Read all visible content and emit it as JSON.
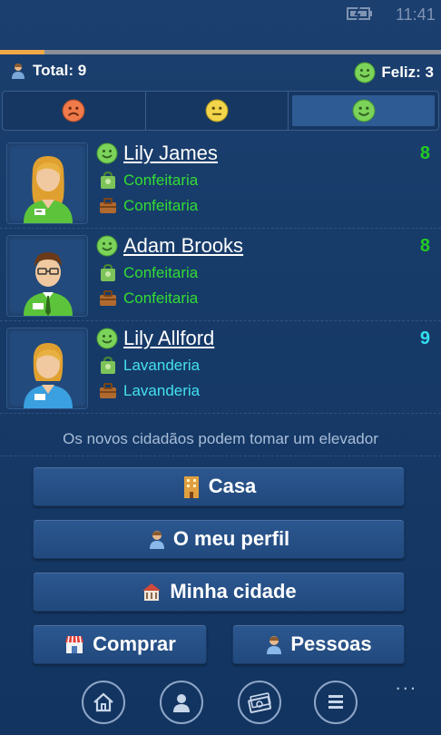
{
  "status_bar": {
    "time": "11:41"
  },
  "progress": {
    "fraction": 0.1
  },
  "summary": {
    "total_label": "Total: 9",
    "happy_label": "Feliz: 3"
  },
  "tabs": [
    {
      "name": "unhappy",
      "active": false
    },
    {
      "name": "neutral",
      "active": false
    },
    {
      "name": "happy",
      "active": true
    }
  ],
  "citizens": [
    {
      "name": "Lily James",
      "score": "8",
      "score_color": "#22cc22",
      "home": "Confeitaria",
      "work": "Confeitaria",
      "job_color": "#33dd33",
      "avatar": "woman-green"
    },
    {
      "name": "Adam Brooks",
      "score": "8",
      "score_color": "#22cc22",
      "home": "Confeitaria",
      "work": "Confeitaria",
      "job_color": "#33dd33",
      "avatar": "man-green"
    },
    {
      "name": "Lily Allford",
      "score": "9",
      "score_color": "#33ddee",
      "home": "Lavanderia",
      "work": "Lavanderia",
      "job_color": "#44e0ee",
      "avatar": "woman-blue"
    }
  ],
  "notice": "Os novos cidadãos podem tomar um elevador",
  "buttons": {
    "casa": "Casa",
    "perfil": "O meu perfil",
    "cidade": "Minha cidade",
    "comprar": "Comprar",
    "pessoas": "Pessoas"
  },
  "appbar": {
    "more": "..."
  }
}
